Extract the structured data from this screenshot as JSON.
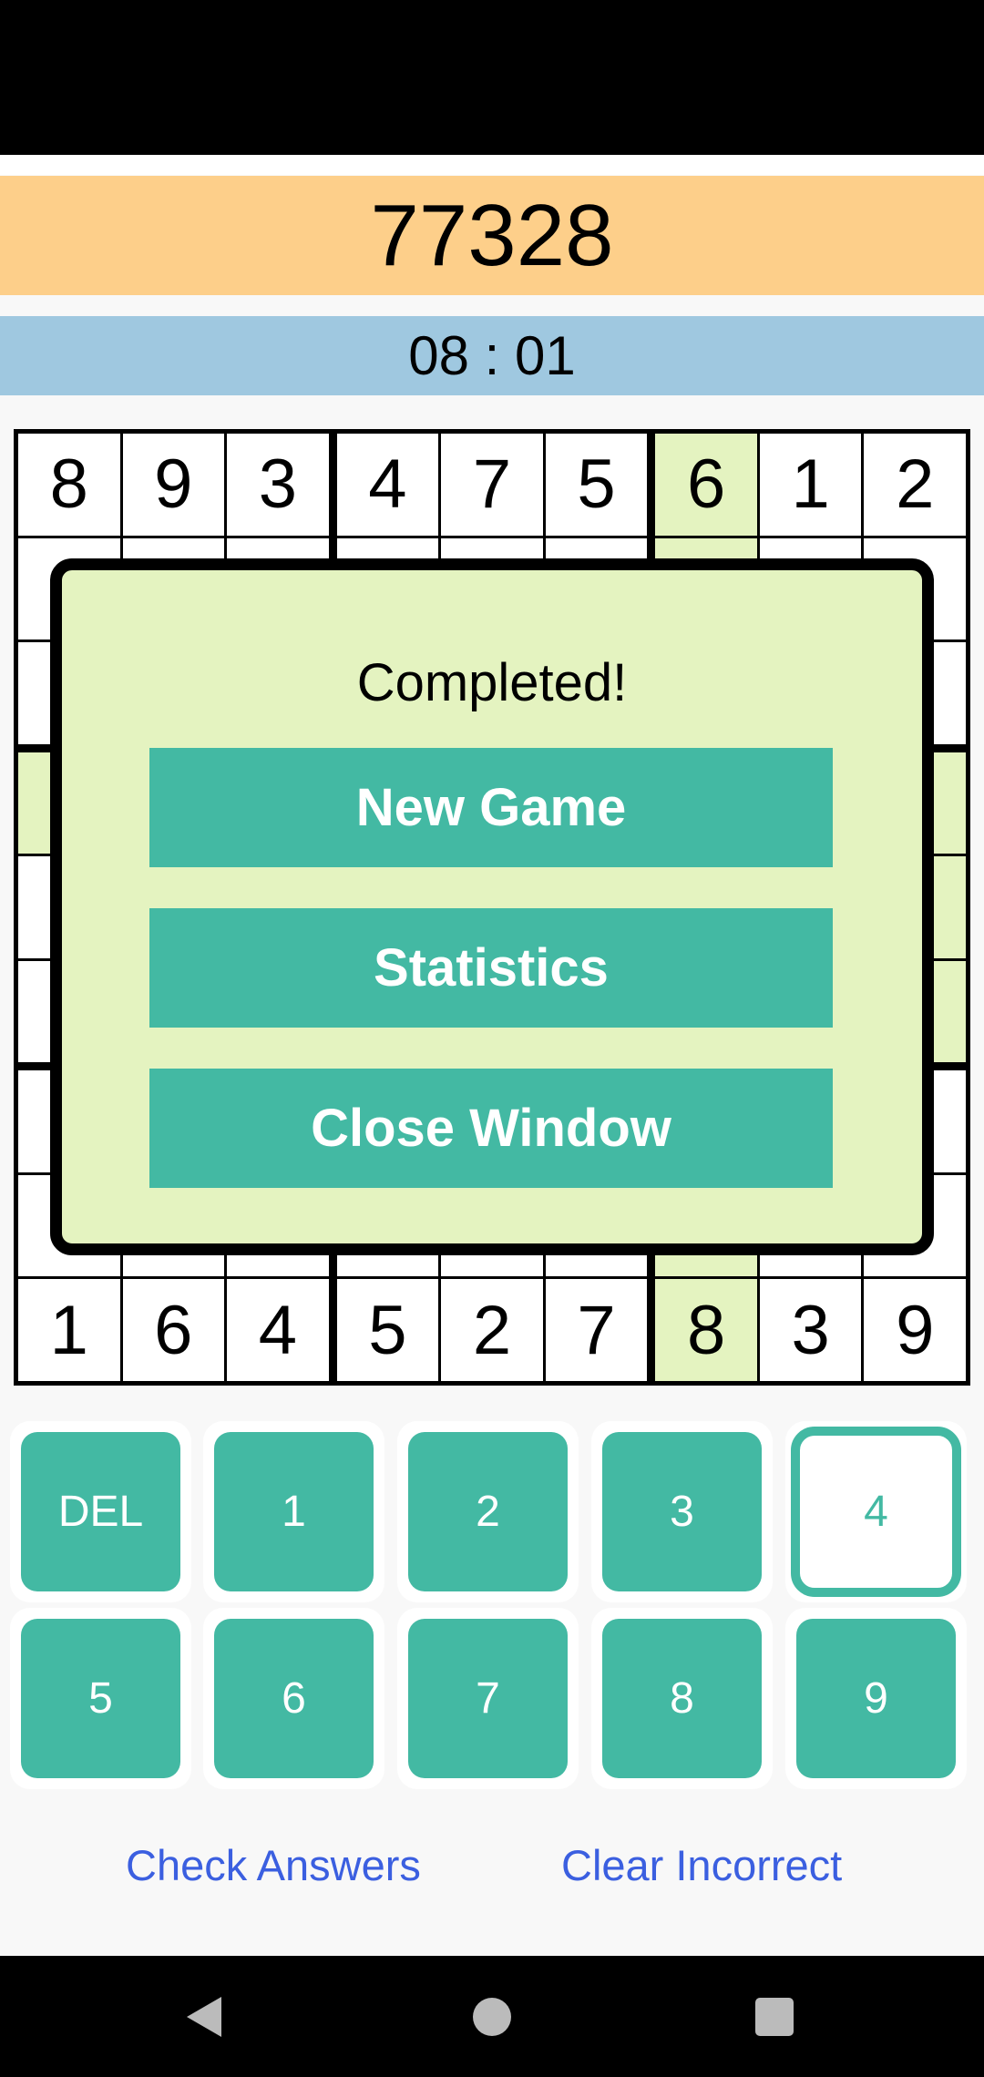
{
  "header": {
    "score": "77328",
    "timer": "08 : 01"
  },
  "grid": {
    "rows": [
      [
        "8",
        "9",
        "3",
        "4",
        "7",
        "5",
        "6",
        "1",
        "2"
      ],
      [
        "",
        "",
        "",
        "",
        "",
        "",
        "",
        "",
        ""
      ],
      [
        "",
        "",
        "",
        "",
        "",
        "",
        "",
        "",
        ""
      ],
      [
        "",
        "",
        "",
        "",
        "",
        "",
        "",
        "",
        ""
      ],
      [
        "",
        "",
        "",
        "",
        "",
        "",
        "",
        "",
        ""
      ],
      [
        "",
        "",
        "",
        "",
        "",
        "",
        "",
        "",
        ""
      ],
      [
        "",
        "",
        "",
        "",
        "",
        "",
        "",
        "",
        ""
      ],
      [
        "",
        "",
        "",
        "",
        "",
        "",
        "",
        "",
        ""
      ],
      [
        "1",
        "6",
        "4",
        "5",
        "2",
        "7",
        "8",
        "3",
        "9"
      ]
    ],
    "selected_row": 3,
    "selected_col": 6,
    "highlight_color": "#e4f3c0"
  },
  "modal": {
    "title": "Completed!",
    "new_game": "New Game",
    "statistics": "Statistics",
    "close_window": "Close Window"
  },
  "keypad": {
    "keys": [
      "DEL",
      "1",
      "2",
      "3",
      "4",
      "5",
      "6",
      "7",
      "8",
      "9"
    ],
    "selected": "4",
    "accent": "#43b9a3"
  },
  "links": {
    "check": "Check Answers",
    "clear": "Clear Incorrect"
  },
  "navbar": {
    "icons": [
      "back-icon",
      "home-icon",
      "recents-icon"
    ]
  }
}
